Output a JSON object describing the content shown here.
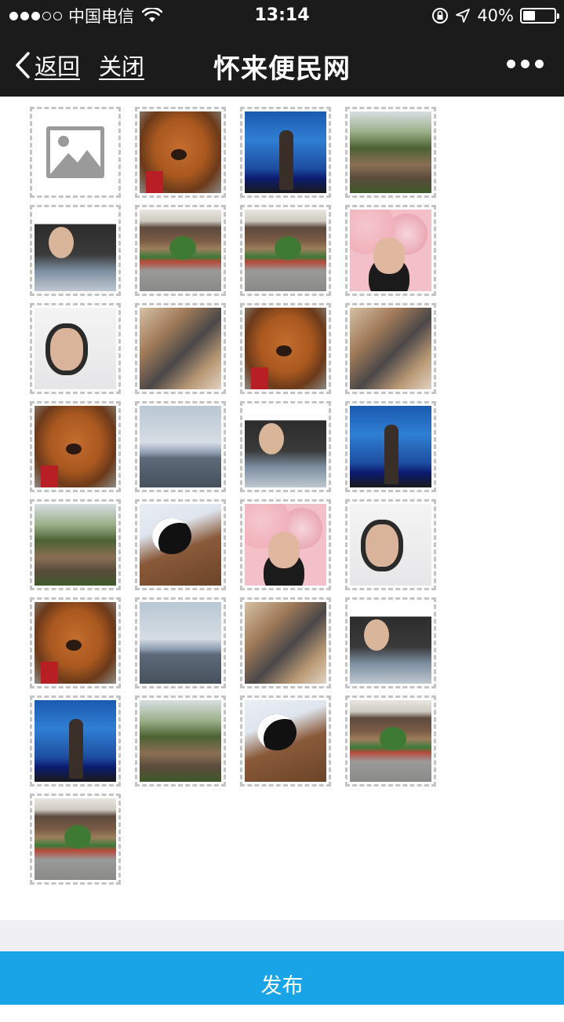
{
  "status_bar": {
    "carrier": "中国电信",
    "time": "13:14",
    "battery_text": "40%",
    "battery_level": 0.4,
    "signal_bars_filled": 3,
    "signal_bars_total": 5,
    "icons": [
      "wifi-icon",
      "orientation-lock-icon",
      "location-arrow-icon",
      "battery-icon"
    ]
  },
  "nav": {
    "back_label": "返回",
    "close_label": "关闭",
    "title": "怀来便民网",
    "back_icon": "chevron-left-icon",
    "more_icon": "more-dots-icon"
  },
  "grid": {
    "add_tile_icon": "image-placeholder-icon",
    "photos": [
      {
        "subject": "dog"
      },
      {
        "subject": "aquarium"
      },
      {
        "subject": "rock-garden"
      },
      {
        "subject": "car-selfie"
      },
      {
        "subject": "drum-tower"
      },
      {
        "subject": "drum-tower"
      },
      {
        "subject": "pink-wall-portrait"
      },
      {
        "subject": "selfie"
      },
      {
        "subject": "blurry-hand"
      },
      {
        "subject": "dog"
      },
      {
        "subject": "blurry-hand"
      },
      {
        "subject": "dog"
      },
      {
        "subject": "river-skyline"
      },
      {
        "subject": "car-selfie"
      },
      {
        "subject": "aquarium"
      },
      {
        "subject": "rock-garden"
      },
      {
        "subject": "kumamon-plush"
      },
      {
        "subject": "pink-wall-portrait"
      },
      {
        "subject": "selfie"
      },
      {
        "subject": "dog"
      },
      {
        "subject": "river-skyline"
      },
      {
        "subject": "blurry-hand"
      },
      {
        "subject": "car-selfie"
      },
      {
        "subject": "aquarium"
      },
      {
        "subject": "rock-garden"
      },
      {
        "subject": "kumamon-plush"
      },
      {
        "subject": "drum-tower"
      },
      {
        "subject": "drum-tower"
      }
    ]
  },
  "footer": {
    "publish_label": "发布"
  },
  "colors": {
    "nav_background": "#1b1b1c",
    "publish_button": "#1aa4e8",
    "tile_border": "#c4c4c4",
    "footer_band": "#efeff4"
  }
}
